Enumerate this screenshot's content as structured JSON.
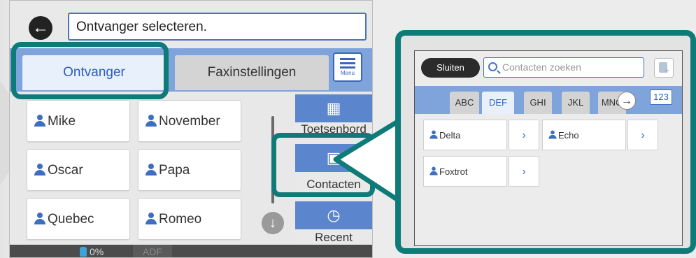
{
  "main": {
    "title": "Ontvanger selecteren.",
    "tabs": [
      "Ontvanger",
      "Faxinstellingen"
    ],
    "menu_label": "Menu",
    "contacts": [
      "Mike",
      "November",
      "Oscar",
      "Papa",
      "Quebec",
      "Romeo"
    ],
    "side_buttons": {
      "keypad": "Toetsenbord",
      "contacts": "Contacten",
      "recent": "Recent"
    },
    "status": {
      "ink": "0%",
      "adf": "ADF"
    }
  },
  "zoom": {
    "close_label": "Sluiten",
    "search_placeholder": "Contacten zoeken",
    "alpha_tabs": [
      "ABC",
      "DEF",
      "GHI",
      "JKL",
      "MNO"
    ],
    "numeric_tab": "123",
    "contacts": [
      "Delta",
      "Echo",
      "Foxtrot"
    ]
  },
  "colors": {
    "accent": "#0e7b78",
    "tab_bar": "#7fa3db",
    "brand_blue": "#3e6ec0"
  }
}
